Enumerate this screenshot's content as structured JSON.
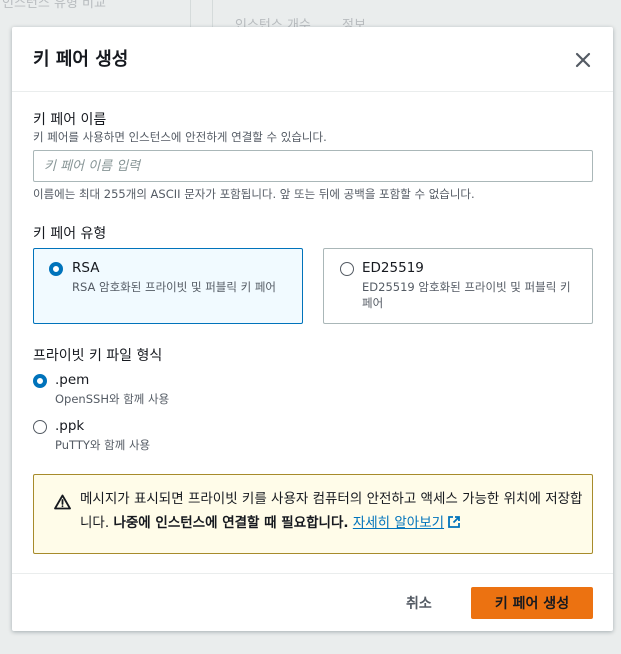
{
  "background": {
    "text_top_left": "인스턴스 유형 비교",
    "text_top_right_1": "인스턴스 개수",
    "text_top_right_2": "정보"
  },
  "modal": {
    "title": "키 페어 생성",
    "close_icon": "close-icon"
  },
  "name_field": {
    "label": "키 페어 이름",
    "description": "키 페어를 사용하면 인스턴스에 안전하게 연결할 수 있습니다.",
    "placeholder": "키 페어 이름 입력",
    "value": "",
    "constraint": "이름에는 최대 255개의 ASCII 문자가 포함됩니다. 앞 또는 뒤에 공백을 포함할 수 없습니다."
  },
  "key_type": {
    "label": "키 페어 유형",
    "options": [
      {
        "title": "RSA",
        "description": "RSA 암호화된 프라이빗 및 퍼블릭 키 페어",
        "selected": true
      },
      {
        "title": "ED25519",
        "description": "ED25519 암호화된 프라이빗 및 퍼블릭 키 페어",
        "selected": false
      }
    ]
  },
  "file_format": {
    "label": "프라이빗 키 파일 형식",
    "options": [
      {
        "title": ".pem",
        "description": "OpenSSH와 함께 사용",
        "selected": true
      },
      {
        "title": ".ppk",
        "description": "PuTTY와 함께 사용",
        "selected": false
      }
    ]
  },
  "alert": {
    "icon": "warning-icon",
    "text_normal": "메시지가 표시되면 프라이빗 키를 사용자 컴퓨터의 안전하고 액세스 가능한 위치에 저장합니다. ",
    "text_bold": "나중에 인스턴스에 연결할 때 필요합니다.",
    "link_label": "자세히 알아보기",
    "link_icon": "external-link-icon",
    "color_border": "#a78b2b",
    "color_background": "#fffce9"
  },
  "footer": {
    "cancel_label": "취소",
    "create_label": "키 페어 생성"
  },
  "colors": {
    "primary": "#ec7211",
    "accent": "#0073bb"
  }
}
